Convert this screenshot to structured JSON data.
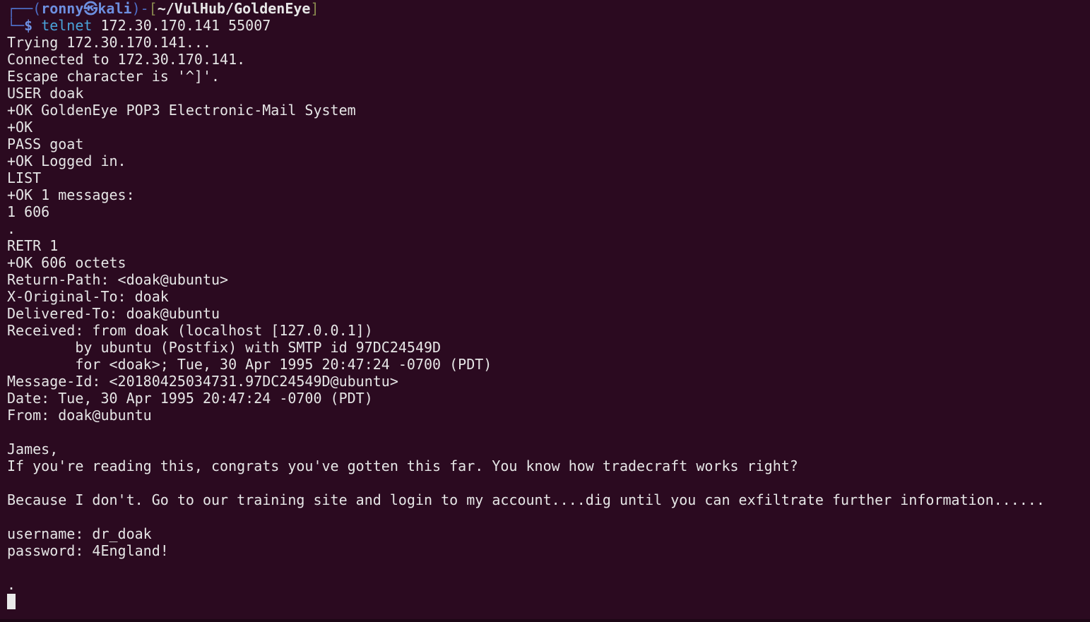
{
  "prompt": {
    "user": "ronny",
    "symbol": "㉿",
    "host": "kali",
    "path": "~/VulHub/GoldenEye",
    "dollar": "$",
    "command": "telnet",
    "args": "172.30.170.141 55007"
  },
  "output": [
    "Trying 172.30.170.141...",
    "Connected to 172.30.170.141.",
    "Escape character is '^]'.",
    "USER doak",
    "+OK GoldenEye POP3 Electronic-Mail System",
    "+OK",
    "PASS goat",
    "+OK Logged in.",
    "LIST",
    "+OK 1 messages:",
    "1 606",
    ".",
    "RETR 1",
    "+OK 606 octets",
    "Return-Path: <doak@ubuntu>",
    "X-Original-To: doak",
    "Delivered-To: doak@ubuntu",
    "Received: from doak (localhost [127.0.0.1])",
    "        by ubuntu (Postfix) with SMTP id 97DC24549D",
    "        for <doak>; Tue, 30 Apr 1995 20:47:24 -0700 (PDT)",
    "Message-Id: <20180425034731.97DC24549D@ubuntu>",
    "Date: Tue, 30 Apr 1995 20:47:24 -0700 (PDT)",
    "From: doak@ubuntu",
    "",
    "James,",
    "If you're reading this, congrats you've gotten this far. You know how tradecraft works right?",
    "",
    "Because I don't. Go to our training site and login to my account....dig until you can exfiltrate further information......",
    "",
    "username: dr_doak",
    "password: 4England!",
    "",
    "."
  ],
  "colors": {
    "background": "#2b0a20",
    "text": "#e6e6e6",
    "prompt_accent": "#6d8fe0",
    "command": "#4aa3d9"
  }
}
